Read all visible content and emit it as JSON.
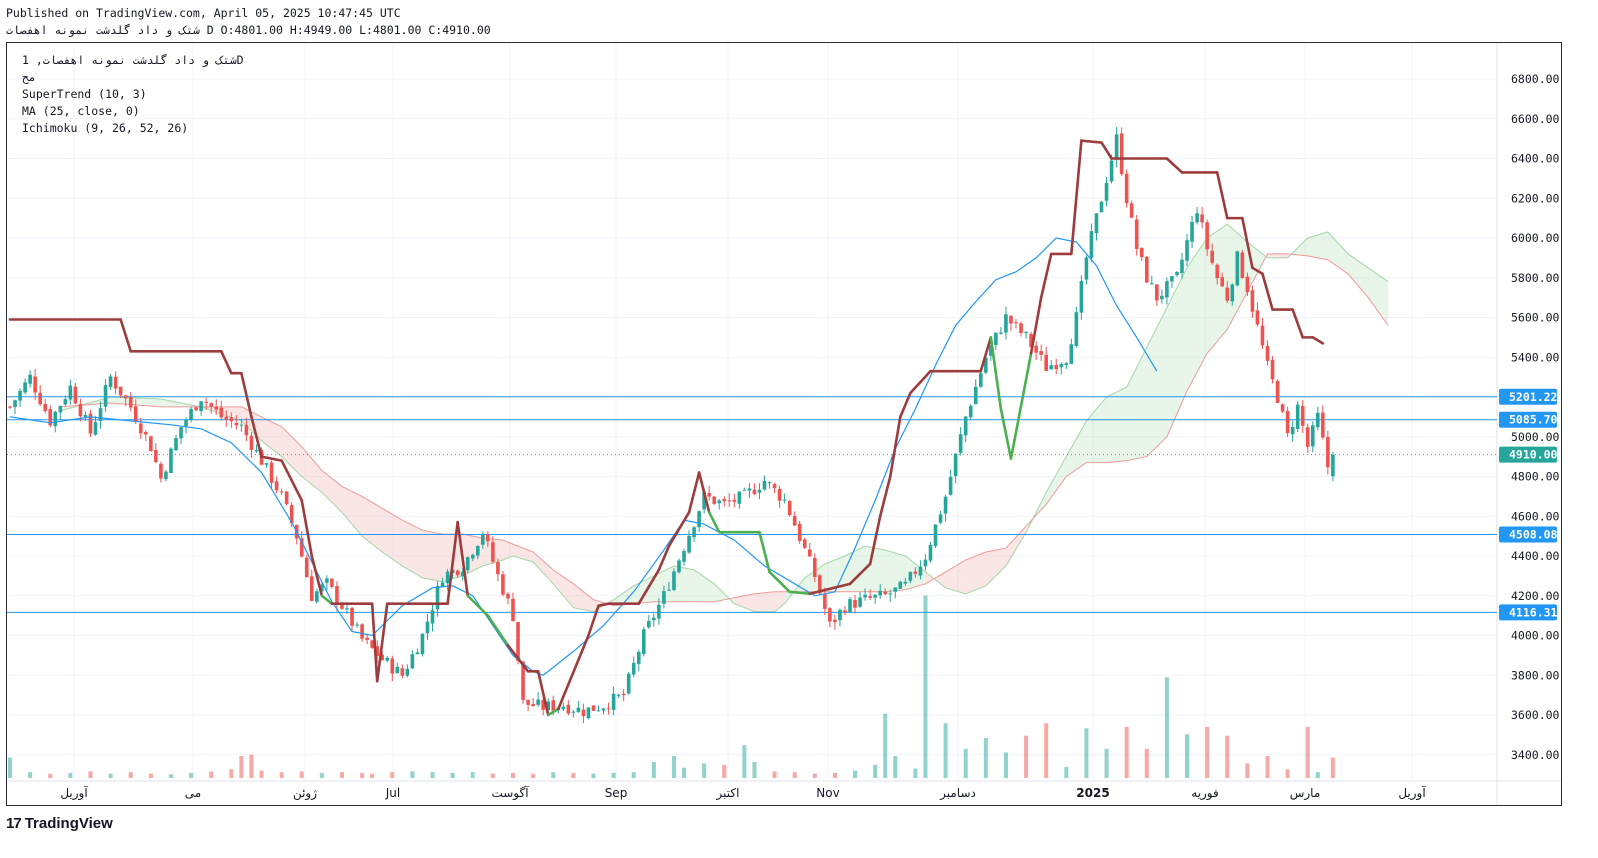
{
  "header": {
    "published": "Published on TradingView.com, April 05, 2025 10:47:45 UTC",
    "ohlc_line": "شتک و داد گلدشت نمونه اهفصات D O:4801.00 H:4949.00 L:4801.00 C:4910.00"
  },
  "legend": {
    "symbol_line": "شتک و داد گلدشت نمونه اهفصات, 1D",
    "line2": "مح",
    "supertrend": "SuperTrend (10, 3)",
    "ma": "MA (25, close, 0)",
    "ichimoku": "Ichimoku (9, 26, 52, 26)"
  },
  "branding": {
    "logo_text": "TradingView"
  },
  "colors": {
    "up": "#26a69a",
    "down": "#ef5350",
    "supertrend_up": "#4caf50",
    "supertrend_down": "#9c3c3c",
    "ma": "#2196f3",
    "hline": "#2196f3",
    "cloud_green": "#a5d6a7",
    "cloud_red": "#ef9a9a"
  },
  "chart_data": {
    "type": "candlestick",
    "title": "",
    "ylim": [
      3200,
      6950
    ],
    "y_ticks": [
      "6800.00",
      "6600.00",
      "6400.00",
      "6200.00",
      "6000.00",
      "5800.00",
      "5600.00",
      "5400.00",
      "5000.00",
      "4800.00",
      "4600.00",
      "4400.00",
      "4200.00",
      "4000.00",
      "3800.00",
      "3600.00",
      "3400.00"
    ],
    "x_labels": [
      "آوریل",
      "می",
      "ژوئن",
      "Jul",
      "آگوست",
      "Sep",
      "اکتبر",
      "Nov",
      "دسامبر",
      "2025",
      "فوریه",
      "مارس",
      "آوریل"
    ],
    "horizontal_lines": [
      {
        "label": "5201.22",
        "value": 5201.22
      },
      {
        "label": "5085.70",
        "value": 5085.7
      },
      {
        "label": "4508.08",
        "value": 4508.08
      },
      {
        "label": "4116.31",
        "value": 4116.31
      }
    ],
    "last_price": {
      "label": "4910.00",
      "value": 4910
    },
    "ohlc": {
      "open": 4801,
      "high": 4949,
      "low": 4801,
      "close": 4910
    },
    "close_path": [
      [
        0,
        5150
      ],
      [
        4,
        5300
      ],
      [
        8,
        5080
      ],
      [
        12,
        5250
      ],
      [
        16,
        5020
      ],
      [
        20,
        5300
      ],
      [
        24,
        5150
      ],
      [
        28,
        4950
      ],
      [
        30,
        4790
      ],
      [
        34,
        5050
      ],
      [
        38,
        5200
      ],
      [
        42,
        5100
      ],
      [
        46,
        5050
      ],
      [
        50,
        4880
      ],
      [
        54,
        4700
      ],
      [
        57,
        4500
      ],
      [
        60,
        4200
      ],
      [
        63,
        4260
      ],
      [
        66,
        4150
      ],
      [
        70,
        3980
      ],
      [
        74,
        3880
      ],
      [
        78,
        3800
      ],
      [
        82,
        4000
      ],
      [
        86,
        4300
      ],
      [
        90,
        4350
      ],
      [
        94,
        4520
      ],
      [
        97,
        4300
      ],
      [
        100,
        4100
      ],
      [
        102,
        3660
      ],
      [
        106,
        3640
      ],
      [
        110,
        3650
      ],
      [
        114,
        3620
      ],
      [
        118,
        3650
      ],
      [
        122,
        3700
      ],
      [
        126,
        4000
      ],
      [
        130,
        4200
      ],
      [
        134,
        4450
      ],
      [
        138,
        4700
      ],
      [
        142,
        4660
      ],
      [
        146,
        4700
      ],
      [
        150,
        4780
      ],
      [
        154,
        4680
      ],
      [
        156,
        4560
      ],
      [
        160,
        4300
      ],
      [
        163,
        4050
      ],
      [
        166,
        4150
      ],
      [
        170,
        4180
      ],
      [
        174,
        4200
      ],
      [
        178,
        4250
      ],
      [
        182,
        4400
      ],
      [
        186,
        4700
      ],
      [
        190,
        5100
      ],
      [
        194,
        5400
      ],
      [
        198,
        5600
      ],
      [
        202,
        5500
      ],
      [
        206,
        5350
      ],
      [
        210,
        5400
      ],
      [
        212,
        5600
      ],
      [
        214,
        5900
      ],
      [
        216,
        6100
      ],
      [
        218,
        6300
      ],
      [
        220,
        6500
      ],
      [
        222,
        6200
      ],
      [
        224,
        5950
      ],
      [
        226,
        5800
      ],
      [
        228,
        5700
      ],
      [
        230,
        5750
      ],
      [
        232,
        5800
      ],
      [
        234,
        5980
      ],
      [
        236,
        6150
      ],
      [
        238,
        5950
      ],
      [
        240,
        5800
      ],
      [
        242,
        5700
      ],
      [
        244,
        5900
      ],
      [
        246,
        5750
      ],
      [
        248,
        5550
      ],
      [
        250,
        5350
      ],
      [
        252,
        5200
      ],
      [
        254,
        5000
      ],
      [
        256,
        5150
      ],
      [
        258,
        4950
      ],
      [
        260,
        5100
      ],
      [
        262,
        4850
      ],
      [
        263,
        4910
      ]
    ],
    "supertrend": [
      [
        0,
        5590
      ],
      [
        22,
        5590
      ],
      [
        24,
        5430
      ],
      [
        42,
        5430
      ],
      [
        44,
        5320
      ],
      [
        46,
        5320
      ],
      [
        48,
        5100
      ],
      [
        50,
        4900
      ],
      [
        54,
        4880
      ],
      [
        58,
        4680
      ],
      [
        60,
        4400
      ],
      [
        62,
        4200
      ],
      [
        64,
        4160
      ],
      [
        72,
        4160
      ],
      [
        73,
        3770
      ],
      [
        75,
        4160
      ],
      [
        87,
        4160
      ],
      [
        89,
        4570
      ],
      [
        91,
        4200
      ],
      [
        95,
        4100
      ],
      [
        99,
        3950
      ],
      [
        103,
        3820
      ],
      [
        105,
        3820
      ],
      [
        107,
        3600
      ],
      [
        109,
        3630
      ],
      [
        115,
        4000
      ],
      [
        117,
        4150
      ],
      [
        119,
        4160
      ],
      [
        125,
        4160
      ],
      [
        129,
        4330
      ],
      [
        131,
        4450
      ],
      [
        135,
        4620
      ],
      [
        137,
        4820
      ],
      [
        139,
        4620
      ],
      [
        141,
        4520
      ],
      [
        149,
        4520
      ],
      [
        151,
        4320
      ],
      [
        155,
        4220
      ],
      [
        159,
        4210
      ],
      [
        167,
        4260
      ],
      [
        171,
        4360
      ],
      [
        173,
        4600
      ],
      [
        175,
        4800
      ],
      [
        177,
        5100
      ],
      [
        179,
        5220
      ],
      [
        183,
        5330
      ],
      [
        193,
        5330
      ],
      [
        195,
        5500
      ],
      [
        197,
        5140
      ],
      [
        199,
        4890
      ],
      [
        203,
        5420
      ],
      [
        205,
        5700
      ],
      [
        207,
        5920
      ],
      [
        211,
        5920
      ],
      [
        213,
        6490
      ],
      [
        217,
        6480
      ],
      [
        219,
        6400
      ],
      [
        230,
        6400
      ],
      [
        233,
        6330
      ],
      [
        240,
        6330
      ],
      [
        242,
        6100
      ],
      [
        245,
        6100
      ],
      [
        247,
        5850
      ],
      [
        249,
        5820
      ],
      [
        251,
        5640
      ],
      [
        255,
        5640
      ],
      [
        257,
        5500
      ],
      [
        259,
        5500
      ],
      [
        261,
        5470
      ]
    ],
    "ma": [
      [
        0,
        5100
      ],
      [
        8,
        5070
      ],
      [
        16,
        5100
      ],
      [
        24,
        5080
      ],
      [
        32,
        5060
      ],
      [
        38,
        5040
      ],
      [
        44,
        4970
      ],
      [
        50,
        4820
      ],
      [
        56,
        4570
      ],
      [
        60,
        4370
      ],
      [
        64,
        4170
      ],
      [
        68,
        4020
      ],
      [
        72,
        4000
      ],
      [
        78,
        4150
      ],
      [
        84,
        4240
      ],
      [
        88,
        4250
      ],
      [
        92,
        4200
      ],
      [
        96,
        4050
      ],
      [
        100,
        3900
      ],
      [
        104,
        3820
      ],
      [
        106,
        3800
      ],
      [
        112,
        3920
      ],
      [
        118,
        4050
      ],
      [
        124,
        4220
      ],
      [
        130,
        4430
      ],
      [
        134,
        4580
      ],
      [
        138,
        4560
      ],
      [
        144,
        4480
      ],
      [
        150,
        4350
      ],
      [
        156,
        4260
      ],
      [
        160,
        4200
      ],
      [
        164,
        4220
      ],
      [
        168,
        4440
      ],
      [
        172,
        4680
      ],
      [
        176,
        4940
      ],
      [
        180,
        5140
      ],
      [
        184,
        5360
      ],
      [
        188,
        5560
      ],
      [
        192,
        5680
      ],
      [
        196,
        5790
      ],
      [
        200,
        5830
      ],
      [
        204,
        5900
      ],
      [
        208,
        6000
      ],
      [
        212,
        5980
      ],
      [
        216,
        5860
      ],
      [
        220,
        5660
      ],
      [
        224,
        5500
      ],
      [
        228,
        5330
      ]
    ],
    "cloud": {
      "span_a": [
        [
          10,
          5130
        ],
        [
          20,
          5200
        ],
        [
          30,
          5190
        ],
        [
          38,
          5150
        ],
        [
          46,
          5080
        ],
        [
          50,
          4980
        ],
        [
          54,
          4900
        ],
        [
          58,
          4800
        ],
        [
          62,
          4720
        ],
        [
          66,
          4620
        ],
        [
          70,
          4500
        ],
        [
          74,
          4420
        ],
        [
          78,
          4350
        ],
        [
          82,
          4290
        ],
        [
          86,
          4270
        ],
        [
          90,
          4300
        ],
        [
          94,
          4350
        ],
        [
          98,
          4380
        ],
        [
          100,
          4400
        ],
        [
          104,
          4370
        ],
        [
          108,
          4260
        ],
        [
          112,
          4140
        ],
        [
          116,
          4120
        ],
        [
          120,
          4180
        ],
        [
          124,
          4250
        ],
        [
          128,
          4300
        ],
        [
          132,
          4350
        ],
        [
          136,
          4330
        ],
        [
          140,
          4260
        ],
        [
          144,
          4160
        ],
        [
          148,
          4120
        ],
        [
          152,
          4120
        ],
        [
          154,
          4160
        ],
        [
          158,
          4290
        ],
        [
          162,
          4360
        ],
        [
          166,
          4400
        ],
        [
          170,
          4450
        ],
        [
          174,
          4430
        ],
        [
          178,
          4400
        ],
        [
          182,
          4320
        ],
        [
          186,
          4240
        ],
        [
          190,
          4210
        ],
        [
          194,
          4250
        ],
        [
          198,
          4350
        ],
        [
          202,
          4520
        ],
        [
          206,
          4720
        ],
        [
          210,
          4900
        ],
        [
          214,
          5080
        ],
        [
          218,
          5200
        ],
        [
          222,
          5250
        ],
        [
          226,
          5450
        ],
        [
          230,
          5650
        ],
        [
          234,
          5850
        ],
        [
          238,
          6000
        ],
        [
          242,
          6070
        ],
        [
          246,
          5980
        ],
        [
          250,
          5900
        ],
        [
          254,
          5900
        ],
        [
          258,
          6000
        ],
        [
          262,
          6030
        ],
        [
          266,
          5920
        ],
        [
          270,
          5850
        ],
        [
          274,
          5780
        ]
      ],
      "span_b": [
        [
          10,
          5150
        ],
        [
          20,
          5170
        ],
        [
          30,
          5150
        ],
        [
          38,
          5150
        ],
        [
          46,
          5150
        ],
        [
          50,
          5100
        ],
        [
          54,
          5050
        ],
        [
          58,
          4950
        ],
        [
          62,
          4830
        ],
        [
          66,
          4750
        ],
        [
          70,
          4700
        ],
        [
          74,
          4640
        ],
        [
          78,
          4580
        ],
        [
          82,
          4530
        ],
        [
          86,
          4510
        ],
        [
          90,
          4510
        ],
        [
          94,
          4490
        ],
        [
          98,
          4480
        ],
        [
          100,
          4460
        ],
        [
          104,
          4420
        ],
        [
          108,
          4330
        ],
        [
          112,
          4260
        ],
        [
          116,
          4180
        ],
        [
          120,
          4150
        ],
        [
          124,
          4160
        ],
        [
          128,
          4170
        ],
        [
          132,
          4170
        ],
        [
          136,
          4170
        ],
        [
          140,
          4170
        ],
        [
          144,
          4190
        ],
        [
          148,
          4210
        ],
        [
          152,
          4220
        ],
        [
          154,
          4220
        ],
        [
          158,
          4220
        ],
        [
          162,
          4220
        ],
        [
          166,
          4220
        ],
        [
          170,
          4220
        ],
        [
          174,
          4220
        ],
        [
          178,
          4230
        ],
        [
          182,
          4260
        ],
        [
          186,
          4320
        ],
        [
          190,
          4380
        ],
        [
          194,
          4420
        ],
        [
          198,
          4440
        ],
        [
          202,
          4550
        ],
        [
          206,
          4660
        ],
        [
          210,
          4800
        ],
        [
          214,
          4870
        ],
        [
          218,
          4870
        ],
        [
          222,
          4880
        ],
        [
          226,
          4900
        ],
        [
          230,
          5000
        ],
        [
          234,
          5230
        ],
        [
          238,
          5420
        ],
        [
          242,
          5540
        ],
        [
          246,
          5730
        ],
        [
          250,
          5920
        ],
        [
          254,
          5920
        ],
        [
          258,
          5910
        ],
        [
          262,
          5890
        ],
        [
          266,
          5820
        ],
        [
          270,
          5700
        ],
        [
          274,
          5560
        ]
      ]
    },
    "volume": [
      [
        0,
        28
      ],
      [
        4,
        8
      ],
      [
        8,
        6
      ],
      [
        12,
        7
      ],
      [
        16,
        9
      ],
      [
        20,
        6
      ],
      [
        24,
        8
      ],
      [
        28,
        6
      ],
      [
        32,
        5
      ],
      [
        36,
        7
      ],
      [
        40,
        9
      ],
      [
        44,
        12
      ],
      [
        46,
        30
      ],
      [
        48,
        32
      ],
      [
        50,
        10
      ],
      [
        54,
        8
      ],
      [
        58,
        9
      ],
      [
        62,
        7
      ],
      [
        66,
        8
      ],
      [
        70,
        7
      ],
      [
        72,
        6
      ],
      [
        76,
        8
      ],
      [
        80,
        9
      ],
      [
        84,
        8
      ],
      [
        88,
        7
      ],
      [
        92,
        8
      ],
      [
        96,
        6
      ],
      [
        100,
        7
      ],
      [
        104,
        6
      ],
      [
        108,
        8
      ],
      [
        112,
        7
      ],
      [
        116,
        6
      ],
      [
        120,
        7
      ],
      [
        124,
        8
      ],
      [
        128,
        22
      ],
      [
        132,
        30
      ],
      [
        134,
        14
      ],
      [
        138,
        20
      ],
      [
        142,
        18
      ],
      [
        146,
        45
      ],
      [
        148,
        22
      ],
      [
        152,
        9
      ],
      [
        156,
        8
      ],
      [
        160,
        6
      ],
      [
        164,
        7
      ],
      [
        168,
        10
      ],
      [
        172,
        18
      ],
      [
        174,
        88
      ],
      [
        176,
        30
      ],
      [
        180,
        13
      ],
      [
        182,
        250
      ],
      [
        186,
        75
      ],
      [
        190,
        40
      ],
      [
        194,
        55
      ],
      [
        198,
        35
      ],
      [
        202,
        58
      ],
      [
        206,
        75
      ],
      [
        210,
        15
      ],
      [
        214,
        68
      ],
      [
        218,
        40
      ],
      [
        222,
        70
      ],
      [
        226,
        40
      ],
      [
        230,
        138
      ],
      [
        234,
        60
      ],
      [
        238,
        70
      ],
      [
        242,
        58
      ],
      [
        246,
        20
      ],
      [
        250,
        30
      ],
      [
        254,
        12
      ],
      [
        258,
        70
      ],
      [
        260,
        8
      ],
      [
        263,
        28
      ]
    ]
  }
}
